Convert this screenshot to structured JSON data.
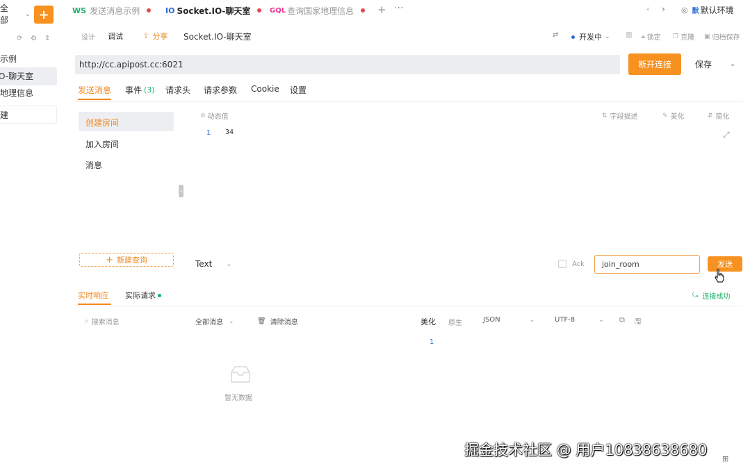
{
  "sidebar": {
    "top_label": "全部",
    "items": [
      {
        "label": "示例"
      },
      {
        "label": "O-聊天室"
      },
      {
        "label": "地理信息"
      },
      {
        "label": "建"
      }
    ]
  },
  "tabs": [
    {
      "prefix": "WS",
      "label": "发送消息示例",
      "prefix_color": "#19b36b"
    },
    {
      "prefix": "IO",
      "label": "Socket.IO-聊天室",
      "prefix_color": "#2f6bd6"
    },
    {
      "prefix": "GQL",
      "label": "查询国家地理信息",
      "prefix_color": "#e0338f"
    }
  ],
  "env": {
    "label": "默认环境"
  },
  "toolbar": {
    "design": "设计",
    "debug": "调试",
    "share": "分享",
    "name": "Socket.IO-聊天室",
    "status": "开发中",
    "lock": "锁定",
    "clone": "克隆",
    "archive": "归档保存"
  },
  "url": {
    "value": "http://cc.apipost.cc:6021"
  },
  "connect_button": "断开连接",
  "save_button": "保存",
  "req_tabs": {
    "send": "发送消息",
    "events": "事件",
    "events_count": "(3)",
    "headers": "请求头",
    "params": "请求参数",
    "cookie": "Cookie",
    "settings": "设置"
  },
  "messages": [
    {
      "label": "创建房间"
    },
    {
      "label": "加入房间"
    },
    {
      "label": "消息"
    }
  ],
  "new_query": "新建查询",
  "editor": {
    "dynamic": "动态值",
    "field_desc": "字段描述",
    "beautify": "美化",
    "simplify": "简化",
    "line_no": "1",
    "content": "34"
  },
  "format": {
    "selected": "Text"
  },
  "ack_label": "Ack",
  "event_input": {
    "value": "join_room"
  },
  "send_button": "发送",
  "resp_tabs": {
    "actual_response": "实时响应",
    "actual_request": "实际请求"
  },
  "connected": "连接成功",
  "resp_toolbar": {
    "search_placeholder": "搜索消息",
    "all_messages": "全部消息",
    "clear": "清除消息",
    "beautify": "美化",
    "raw": "原生",
    "format": "JSON",
    "encoding": "UTF-8"
  },
  "resp_line": "1",
  "empty_text": "暂无数据",
  "watermark": "掘金技术社区 @ 用户1083863868​0"
}
